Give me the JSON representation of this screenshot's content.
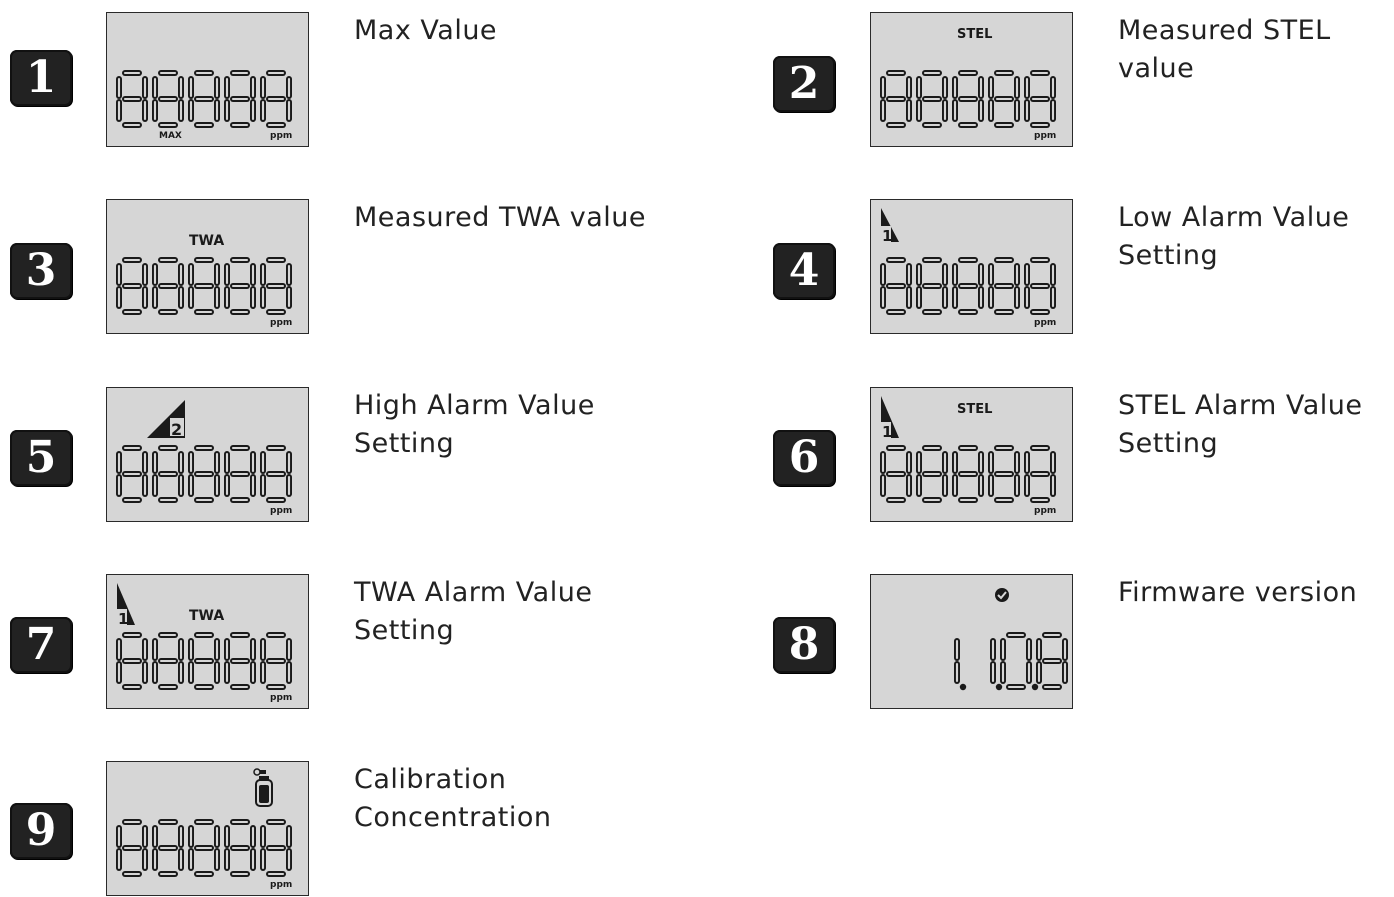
{
  "items": [
    {
      "number": "1",
      "line1": "Max Value",
      "line2": "",
      "digits": "88888",
      "unit": "ppm",
      "top_label": "",
      "bottom_left_label": "MAX"
    },
    {
      "number": "2",
      "line1": "Measured STEL",
      "line2": "value",
      "digits": "88888",
      "unit": "ppm",
      "top_label": "STEL",
      "bottom_left_label": ""
    },
    {
      "number": "3",
      "line1": "Measured TWA value",
      "line2": "",
      "digits": "88888",
      "unit": "ppm",
      "top_label": "TWA",
      "bottom_left_label": ""
    },
    {
      "number": "4",
      "line1": "Low Alarm Value",
      "line2": "Setting",
      "digits": "88888",
      "unit": "ppm",
      "top_label": "",
      "bottom_left_label": "",
      "alarm_flag": "1"
    },
    {
      "number": "5",
      "line1": "High Alarm Value",
      "line2": "Setting",
      "digits": "88888",
      "unit": "ppm",
      "top_label": "",
      "bottom_left_label": "",
      "alarm_flag": "2"
    },
    {
      "number": "6",
      "line1": "STEL Alarm Value",
      "line2": "Setting",
      "digits": "88888",
      "unit": "ppm",
      "top_label": "STEL",
      "bottom_left_label": "",
      "alarm_flag": "1"
    },
    {
      "number": "7",
      "line1": "TWA Alarm Value",
      "line2": "Setting",
      "digits": "88888",
      "unit": "ppm",
      "top_label": "TWA",
      "bottom_left_label": "",
      "alarm_flag": "1"
    },
    {
      "number": "8",
      "line1": "Firmware version",
      "line2": "",
      "digits": "1.1.0.8",
      "unit": "",
      "top_label": "",
      "bottom_left_label": "",
      "icon": "check-circle-icon"
    },
    {
      "number": "9",
      "line1": "Calibration",
      "line2": "Concentration",
      "digits": "88888",
      "unit": "ppm",
      "top_label": "",
      "bottom_left_label": "",
      "icon": "gas-cylinder-icon"
    }
  ]
}
